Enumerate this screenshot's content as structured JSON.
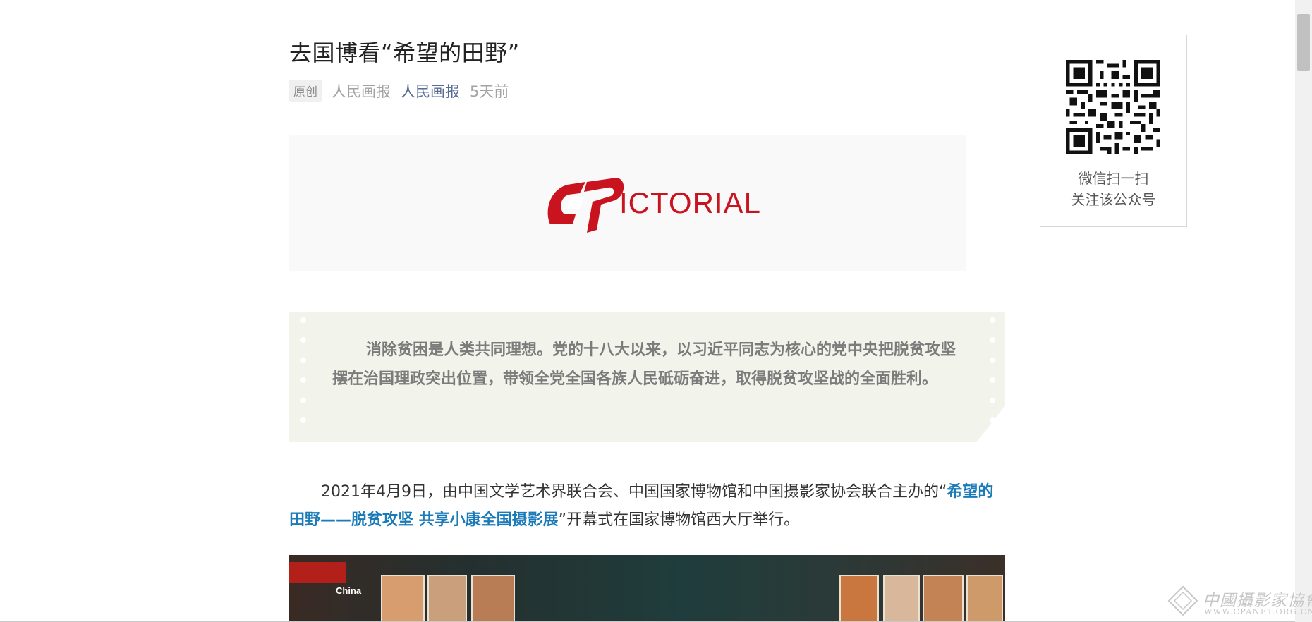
{
  "article": {
    "title": "去国博看“希望的田野”",
    "meta": {
      "badge": "原创",
      "author": "人民画报",
      "account": "人民画报",
      "time": "5天前"
    },
    "logo_text": "ICTORIAL",
    "quote": "消除贫困是人类共同理想。党的十八大以来，以习近平同志为核心的党中央把脱贫攻坚摆在治国理政突出位置，带领全党全国各族人民砥砺奋进，取得脱贫攻坚战的全面胜利。",
    "paragraph": {
      "before": "2021年4月9日，由中国文学艺术界联合会、中国国家博物馆和中国摄影家协会联合主办的“",
      "highlight": "希望的田野——脱贫攻坚 共享小康全国摄影展",
      "after": "”开幕式在国家博物馆西大厅举行。"
    },
    "photo_brand": "China"
  },
  "sidebar": {
    "qr_caption_line1": "微信扫一扫",
    "qr_caption_line2": "关注该公众号"
  },
  "watermark": {
    "cn": "中國攝影家協會",
    "en": "WWW.CPANET.ORG.CN"
  },
  "colors": {
    "account_link": "#576b95",
    "highlight": "#1a7bb8",
    "logo_red": "#c9141f",
    "quote_bg": "#f2f3ea"
  }
}
